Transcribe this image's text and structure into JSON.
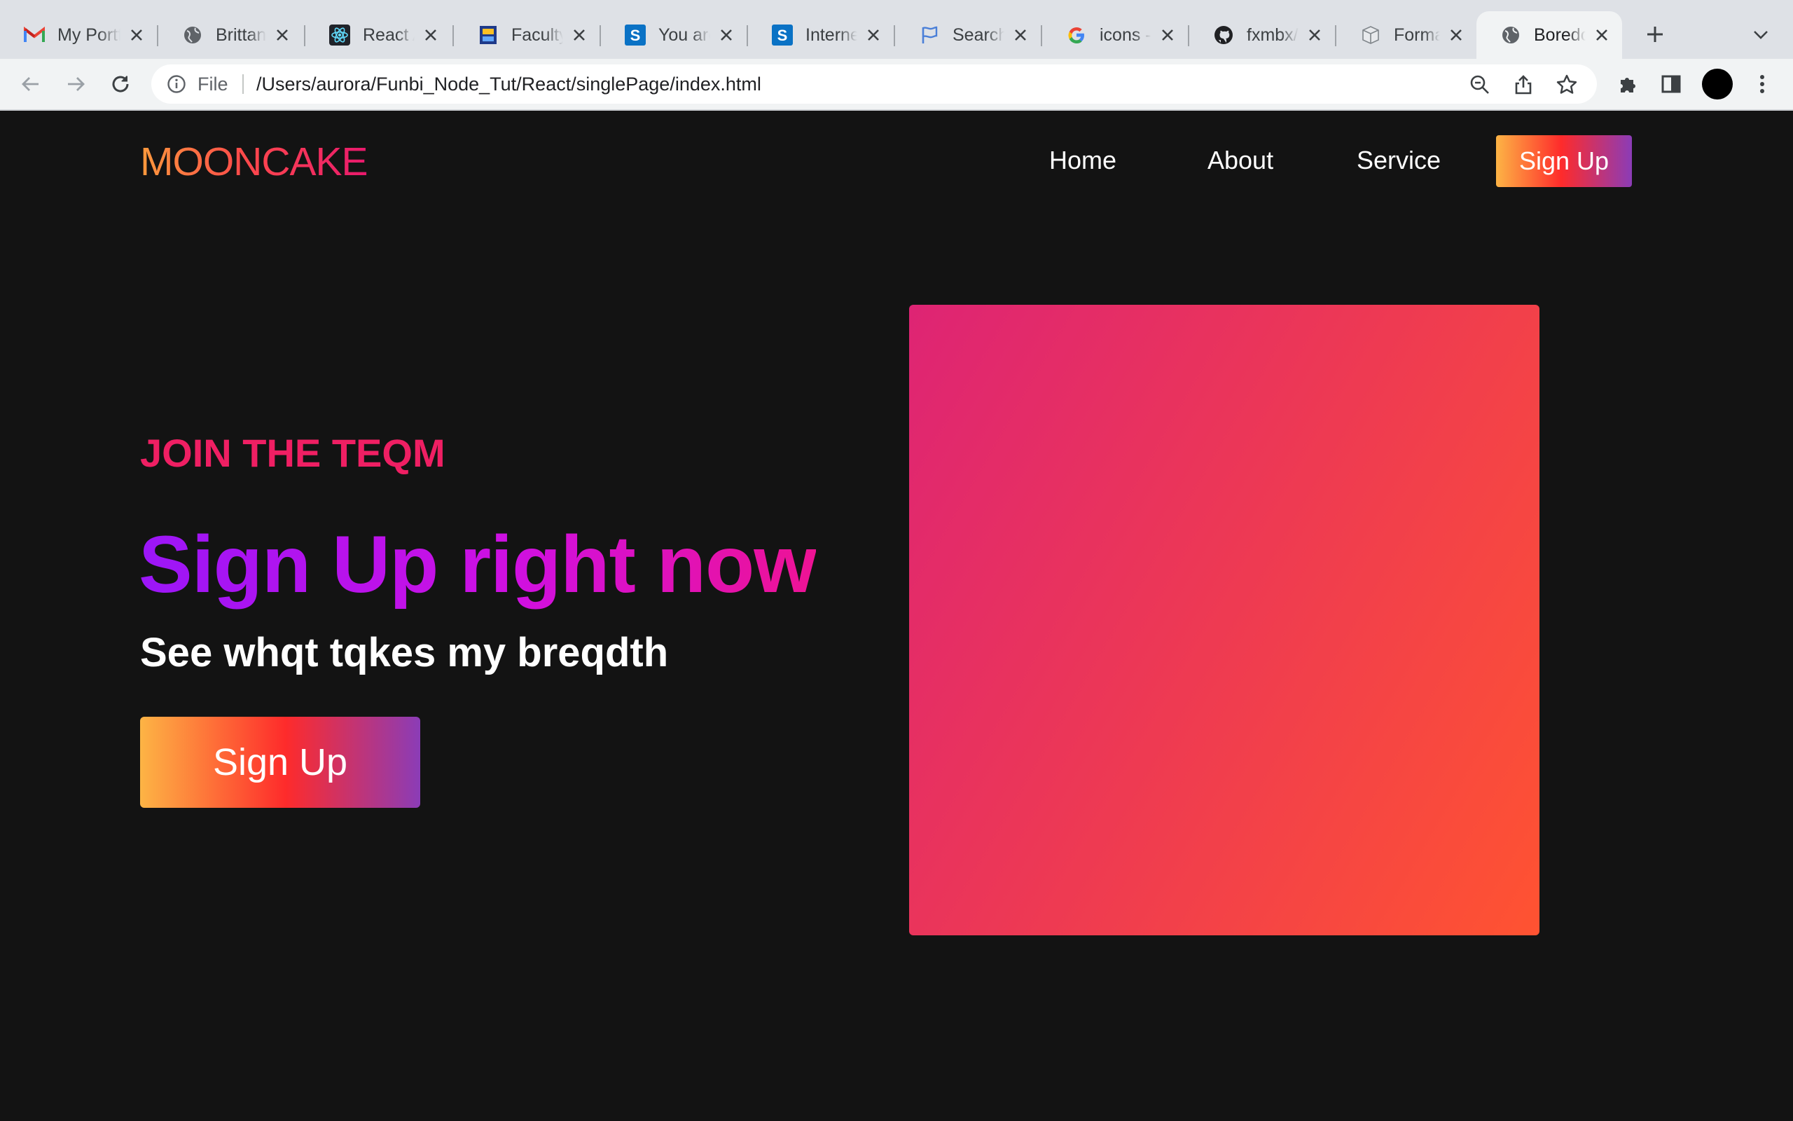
{
  "browser": {
    "tabs": [
      {
        "title": "My Portfolio",
        "icon": "gmail-icon"
      },
      {
        "title": "Brittany",
        "icon": "globe-icon"
      },
      {
        "title": "React App",
        "icon": "react-icon"
      },
      {
        "title": "Faculty",
        "icon": "faculty-icon"
      },
      {
        "title": "You are",
        "icon": "s-icon"
      },
      {
        "title": "Internet",
        "icon": "s-icon"
      },
      {
        "title": "Search",
        "icon": "flag-icon"
      },
      {
        "title": "icons -",
        "icon": "google-icon"
      },
      {
        "title": "fxmbx/",
        "icon": "github-icon"
      },
      {
        "title": "Format",
        "icon": "format-icon"
      },
      {
        "title": "Boredom",
        "icon": "globe-icon",
        "active": true
      }
    ],
    "address": {
      "scheme_label": "File",
      "url": "/Users/aurora/Funbi_Node_Tut/React/singlePage/index.html"
    }
  },
  "site": {
    "logo": "MOONCAKE",
    "nav": {
      "home": "Home",
      "about": "About",
      "service": "Service",
      "signup": "Sign Up"
    },
    "hero": {
      "kicker": "JOIN THE TEQM",
      "headline": "Sign Up right now",
      "subline": "See whqt tqkes my breqdth",
      "cta": "Sign Up"
    }
  },
  "colors": {
    "page_background": "#131313",
    "kicker": "#ef1f63",
    "headline_gradient": [
      "#9b16f8",
      "#ee1394"
    ],
    "button_gradient": [
      "#fdb445",
      "#fe2b2b",
      "#8b3cb7"
    ],
    "hero_box_gradient": [
      "#de2474",
      "#ff5331"
    ]
  }
}
